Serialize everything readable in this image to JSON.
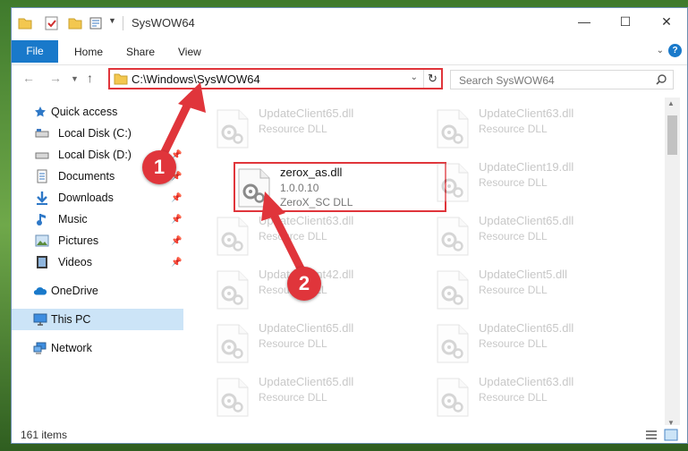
{
  "window": {
    "title": "SysWOW64",
    "controls": {
      "minimize": "—",
      "maximize": "☐",
      "close": "✕"
    }
  },
  "ribbon": {
    "tabs": [
      "File",
      "Home",
      "Share",
      "View"
    ],
    "help": "?"
  },
  "address": {
    "path": "C:\\Windows\\SysWOW64",
    "search_placeholder": "Search SysWOW64"
  },
  "sidebar": {
    "items": [
      {
        "label": "Quick access",
        "icon": "star-icon"
      },
      {
        "label": "Local Disk (C:)",
        "icon": "drive-icon",
        "pinned": true
      },
      {
        "label": "Local Disk (D:)",
        "icon": "drive-icon",
        "pinned": true
      },
      {
        "label": "Documents",
        "icon": "documents-icon",
        "pinned": true
      },
      {
        "label": "Downloads",
        "icon": "download-icon",
        "pinned": true
      },
      {
        "label": "Music",
        "icon": "music-icon",
        "pinned": true
      },
      {
        "label": "Pictures",
        "icon": "pictures-icon",
        "pinned": true
      },
      {
        "label": "Videos",
        "icon": "videos-icon",
        "pinned": true
      },
      {
        "label": "OneDrive",
        "icon": "cloud-icon"
      },
      {
        "label": "This PC",
        "icon": "computer-icon",
        "selected": true
      },
      {
        "label": "Network",
        "icon": "network-icon"
      }
    ]
  },
  "files": {
    "left": [
      {
        "name": "UpdateClient65.dll",
        "desc": "Resource DLL"
      },
      {
        "name": "zerox_as.dll",
        "desc": "1.0.0.10",
        "desc2": "ZeroX_SC DLL",
        "highlighted": true
      },
      {
        "name": "UpdateClient63.dll",
        "desc": "Resource DLL"
      },
      {
        "name": "UpdateClient42.dll",
        "desc": "Resource DLL"
      },
      {
        "name": "UpdateClient65.dll",
        "desc": "Resource DLL"
      },
      {
        "name": "UpdateClient65.dll",
        "desc": "Resource DLL"
      }
    ],
    "right": [
      {
        "name": "UpdateClient63.dll",
        "desc": "Resource DLL"
      },
      {
        "name": "UpdateClient19.dll",
        "desc": "Resource DLL"
      },
      {
        "name": "UpdateClient65.dll",
        "desc": "Resource DLL"
      },
      {
        "name": "UpdateClient5.dll",
        "desc": "Resource DLL"
      },
      {
        "name": "UpdateClient65.dll",
        "desc": "Resource DLL"
      },
      {
        "name": "UpdateClient63.dll",
        "desc": "Resource DLL"
      }
    ]
  },
  "status": {
    "items": "161 items"
  },
  "annotations": {
    "step1": "1",
    "step2": "2"
  },
  "colors": {
    "highlight": "#e0353b",
    "accent": "#1979ca",
    "selection": "#cce4f7"
  }
}
